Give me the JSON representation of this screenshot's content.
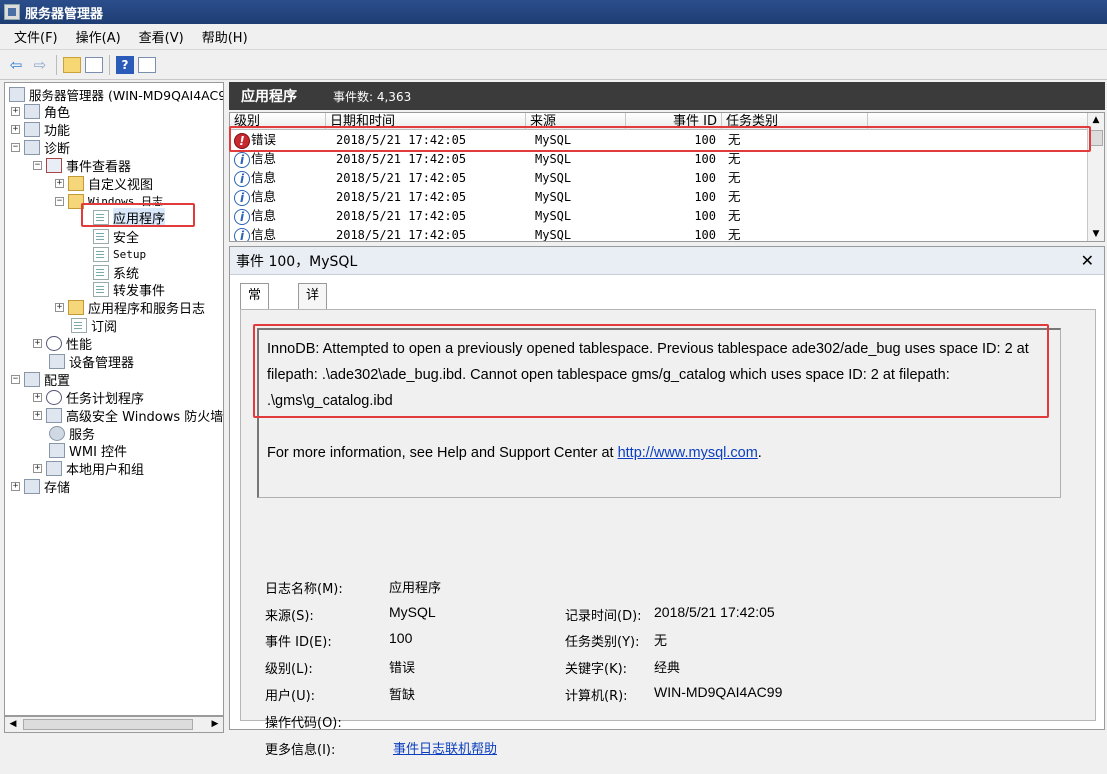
{
  "window": {
    "title": "服务器管理器"
  },
  "menu": [
    "文件(F)",
    "操作(A)",
    "查看(V)",
    "帮助(H)"
  ],
  "tree": {
    "root": "服务器管理器 (WIN-MD9QAI4AC9",
    "items": [
      {
        "label": "角色"
      },
      {
        "label": "功能"
      },
      {
        "label": "诊断"
      },
      {
        "label": "事件查看器"
      },
      {
        "label": "自定义视图"
      },
      {
        "label": "Windows 日志"
      },
      {
        "label": "应用程序"
      },
      {
        "label": "安全"
      },
      {
        "label": "Setup"
      },
      {
        "label": "系统"
      },
      {
        "label": "转发事件"
      },
      {
        "label": "应用程序和服务日志"
      },
      {
        "label": "订阅"
      },
      {
        "label": "性能"
      },
      {
        "label": "设备管理器"
      },
      {
        "label": "配置"
      },
      {
        "label": "任务计划程序"
      },
      {
        "label": "高级安全 Windows 防火墙"
      },
      {
        "label": "服务"
      },
      {
        "label": "WMI 控件"
      },
      {
        "label": "本地用户和组"
      },
      {
        "label": "存储"
      }
    ]
  },
  "pane": {
    "title": "应用程序",
    "count": "事件数: 4,363"
  },
  "columns": [
    "级别",
    "日期和时间",
    "来源",
    "事件 ID",
    "任务类别"
  ],
  "events": [
    {
      "level": "错误",
      "type": "error",
      "datetime": "2018/5/21 17:42:05",
      "source": "MySQL",
      "id": "100",
      "category": "无"
    },
    {
      "level": "信息",
      "type": "info",
      "datetime": "2018/5/21 17:42:05",
      "source": "MySQL",
      "id": "100",
      "category": "无"
    },
    {
      "level": "信息",
      "type": "info",
      "datetime": "2018/5/21 17:42:05",
      "source": "MySQL",
      "id": "100",
      "category": "无"
    },
    {
      "level": "信息",
      "type": "info",
      "datetime": "2018/5/21 17:42:05",
      "source": "MySQL",
      "id": "100",
      "category": "无"
    },
    {
      "level": "信息",
      "type": "info",
      "datetime": "2018/5/21 17:42:05",
      "source": "MySQL",
      "id": "100",
      "category": "无"
    },
    {
      "level": "信息",
      "type": "info",
      "datetime": "2018/5/21 17:42:05",
      "source": "MySQL",
      "id": "100",
      "category": "无"
    }
  ],
  "detail": {
    "title": "事件 100，MySQL",
    "tabs": [
      "常规",
      "详细信息"
    ],
    "message": "InnoDB: Attempted to open a previously opened tablespace. Previous tablespace ade302/ade_bug uses space ID: 2 at filepath: .\\ade302\\ade_bug.ibd. Cannot open tablespace gms/g_catalog which uses space ID: 2 at filepath: .\\gms\\g_catalog.ibd",
    "more_prefix": "For more information, see Help and Support Center at ",
    "more_link": "http://www.mysql.com",
    "more_suffix": ".",
    "props": {
      "log_name_label": "日志名称(M):",
      "log_name": "应用程序",
      "source_label": "来源(S):",
      "source": "MySQL",
      "logged_label": "记录时间(D):",
      "logged": "2018/5/21 17:42:05",
      "event_id_label": "事件 ID(E):",
      "event_id": "100",
      "task_label": "任务类别(Y):",
      "task": "无",
      "level_label": "级别(L):",
      "level": "错误",
      "keywords_label": "关键字(K):",
      "keywords": "经典",
      "user_label": "用户(U):",
      "user": "暂缺",
      "computer_label": "计算机(R):",
      "computer": "WIN-MD9QAI4AC99",
      "opcode_label": "操作代码(O):",
      "more_info_label": "更多信息(I):",
      "more_info_link": "事件日志联机帮助"
    }
  }
}
